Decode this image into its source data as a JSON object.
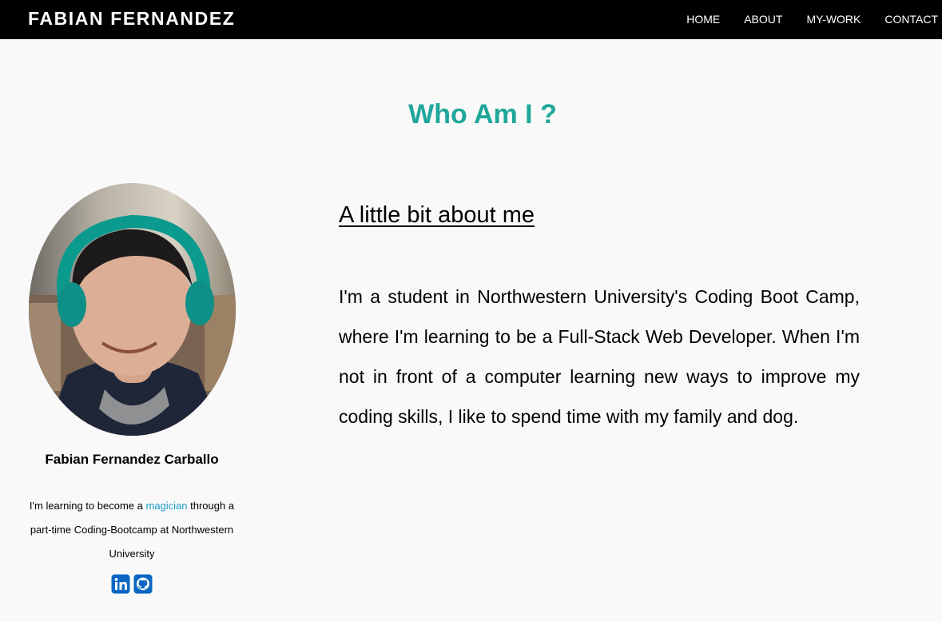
{
  "nav": {
    "brand": "FABIAN FERNANDEZ",
    "links": [
      "HOME",
      "ABOUT",
      "MY-WORK",
      "CONTACT"
    ]
  },
  "page": {
    "title": "Who Am I ?"
  },
  "profile": {
    "name": "Fabian Fernandez Carballo",
    "bio_prefix": "I'm learning to become a",
    "bio_link": "magician",
    "bio_suffix": "through a part-time Coding-Bootcamp at Northwestern University",
    "socials": [
      "linkedin-icon",
      "github-icon"
    ]
  },
  "about": {
    "heading": "A little bit about me",
    "text": "I'm a student in Northwestern University's Coding Boot Camp, where I'm learning to be a Full-Stack Web Developer. When I'm not in front of a computer learning new ways to improve my coding skills, I like to spend time with my family and dog."
  },
  "colors": {
    "navbar": "#000000",
    "accent": "#1fa79b",
    "link": "#1a9bc7",
    "social": "#0a66c2",
    "background": "#f9f9f9"
  }
}
